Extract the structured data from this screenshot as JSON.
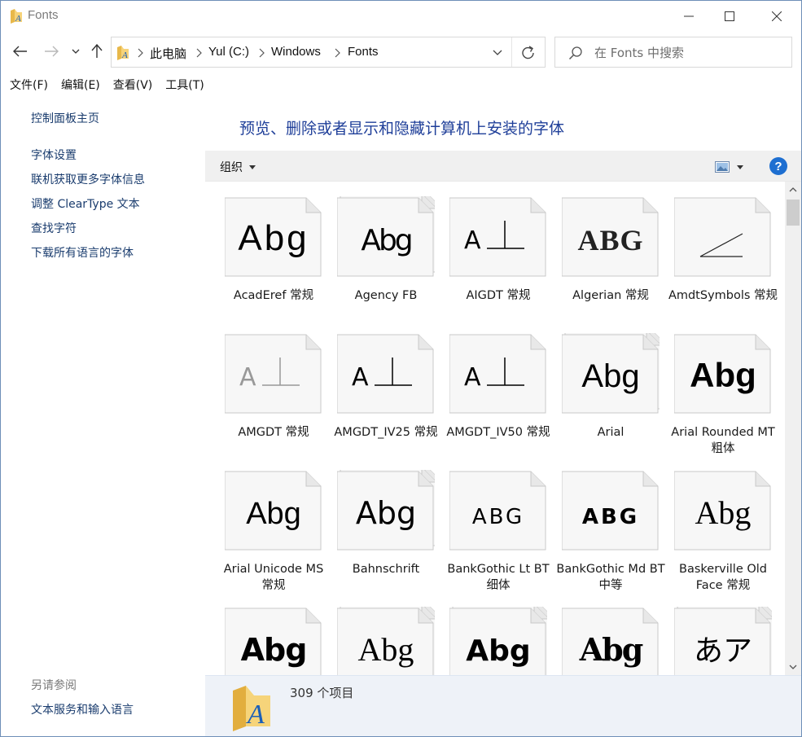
{
  "window": {
    "title": "Fonts",
    "accent": "#1e6fd1",
    "border": "#6e8fb8"
  },
  "caption_buttons": {
    "minimize": "minimize-icon",
    "maximize": "maximize-icon",
    "close": "close-icon"
  },
  "nav": {
    "back": "back-arrow-icon",
    "forward": "forward-arrow-icon",
    "recent": "chevron-down-icon",
    "up": "up-arrow-icon"
  },
  "address": {
    "crumbs": [
      "此电脑",
      "Yul (C:)",
      "Windows",
      "Fonts"
    ]
  },
  "search": {
    "placeholder": "在 Fonts 中搜索"
  },
  "menubar": {
    "items": [
      "文件(F)",
      "编辑(E)",
      "查看(V)",
      "工具(T)"
    ]
  },
  "left_pane": {
    "home_link": "控制面板主页",
    "tasks": [
      "字体设置",
      "联机获取更多字体信息",
      "调整 ClearType 文本",
      "查找字符",
      "下载所有语言的字体"
    ],
    "see_also_title": "另请参阅",
    "see_also": [
      "文本服务和输入语言"
    ]
  },
  "main": {
    "heading": "预览、删除或者显示和隐藏计算机上安装的字体",
    "toolbar": {
      "organize": "组织",
      "help": "?"
    },
    "status_count": "309 个项目"
  },
  "fonts": [
    {
      "name": "AcadEref 常规",
      "preview": "Abg",
      "family": 0
    },
    {
      "name": "Agency FB",
      "preview": "Abg",
      "family": 1
    },
    {
      "name": "AIGDT 常规",
      "preview": "A⊥",
      "family": 2
    },
    {
      "name": "Algerian 常规",
      "preview": "ABG",
      "family": 3
    },
    {
      "name": "AmdtSymbols 常规",
      "preview": "∠",
      "family": 4
    },
    {
      "name": "AMGDT 常规",
      "preview": "A⊥",
      "family": 5
    },
    {
      "name": "AMGDT_IV25 常规",
      "preview": "A⊥",
      "family": 6
    },
    {
      "name": "AMGDT_IV50 常规",
      "preview": "A⊥",
      "family": 7
    },
    {
      "name": "Arial",
      "preview": "Abg",
      "family": 8
    },
    {
      "name": "Arial Rounded MT 粗体",
      "preview": "Abg",
      "family": 9
    },
    {
      "name": "Arial Unicode MS 常规",
      "preview": "Abg",
      "family": 10
    },
    {
      "name": "Bahnschrift",
      "preview": "Abg",
      "family": 11
    },
    {
      "name": "BankGothic Lt BT 细体",
      "preview": "ABG",
      "family": 12
    },
    {
      "name": "BankGothic Md BT 中等",
      "preview": "ABG",
      "family": 13
    },
    {
      "name": "Baskerville Old Face 常规",
      "preview": "Abg",
      "family": 14
    },
    {
      "name": "",
      "preview": "Abg",
      "family": 15
    },
    {
      "name": "",
      "preview": "Abg",
      "family": 16
    },
    {
      "name": "",
      "preview": "Abg",
      "family": 17
    },
    {
      "name": "",
      "preview": "Abg",
      "family": 18
    },
    {
      "name": "",
      "preview": "あア",
      "family": 19
    }
  ]
}
